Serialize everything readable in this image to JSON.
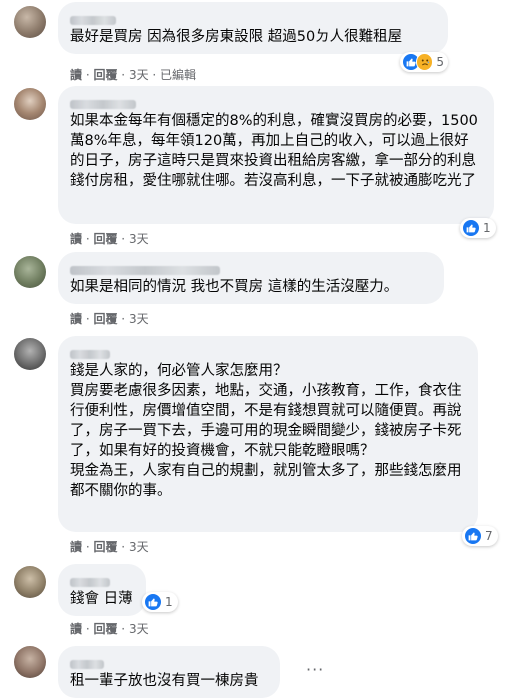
{
  "comments": [
    {
      "text": "最好是買房 因為很多房東設限 超過50ㄉ人很難租屋",
      "actions": [
        "讀",
        "回覆",
        "3天",
        "已編輯"
      ],
      "reaction_count": "5"
    },
    {
      "text": "如果本金每年有個穩定的8%的利息，確實沒買房的必要，1500萬8%年息，每年領120萬，再加上自己的收入，可以過上很好的日子，房子這時只是買來投資出租給房客繳，拿一部分的利息錢付房租，愛住哪就住哪。若沒高利息，一下子就被通膨吃光了",
      "actions": [
        "讀",
        "回覆",
        "3天"
      ],
      "reaction_count": "1"
    },
    {
      "text": "如果是相同的情況 我也不買房 這樣的生活沒壓力。",
      "actions": [
        "讀",
        "回覆",
        "3天"
      ]
    },
    {
      "text": "錢是人家的，何必管人家怎麼用？\n買房要老慮很多因素，地點，交通，小孩教育，工作，食衣住行便利性，房價增值空間，不是有錢想買就可以隨便買。再說了，房子一買下去，手邊可用的現金瞬間變少，錢被房子卡死了，如果有好的投資機會，不就只能乾瞪眼嗎？\n現金為王，人家有自己的規劃，就別管太多了，那些錢怎麼用都不關你的事。",
      "actions": [
        "讀",
        "回覆",
        "3天"
      ],
      "reaction_count": "7"
    },
    {
      "text": "錢會 日薄",
      "actions": [
        "讀",
        "回覆",
        "3天"
      ],
      "reaction_count": "1"
    },
    {
      "text": "租一輩子放也沒有買一棟房貴",
      "more": "···"
    }
  ],
  "separator": " · ",
  "colors": {
    "bubble_bg": "#f0f2f5",
    "like_blue": "#1877f2",
    "sad_yellow": "#f7b125",
    "meta_gray": "#65676b"
  },
  "icons": {
    "like": "like-reaction-icon",
    "sad": "sad-reaction-icon",
    "more": "more-options-icon"
  }
}
